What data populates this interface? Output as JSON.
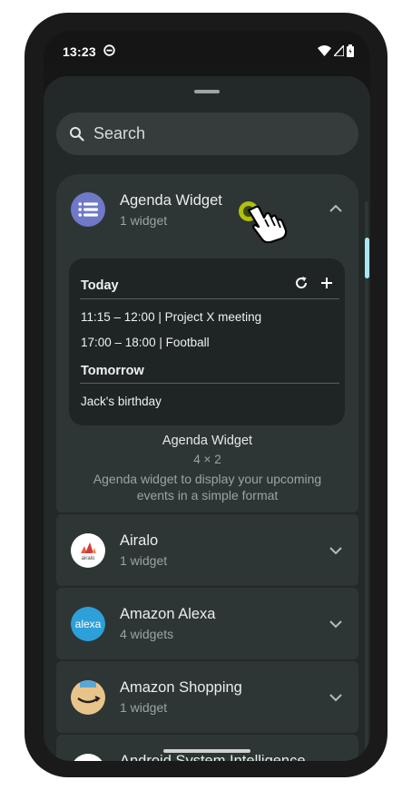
{
  "status": {
    "time": "13:23"
  },
  "search": {
    "placeholder": "Search"
  },
  "expanded_app": {
    "name": "Agenda Widget",
    "count": "1 widget",
    "icon": "list-icon",
    "icon_color": "#6f79c8",
    "preview": {
      "today_label": "Today",
      "events_today": [
        "11:15 – 12:00 | Project X meeting",
        "17:00 – 18:00 | Football"
      ],
      "tomorrow_label": "Tomorrow",
      "events_tomorrow": [
        "Jack's birthday"
      ]
    },
    "widget_title": "Agenda Widget",
    "widget_size": "4 × 2",
    "widget_description": "Agenda widget to display your upcoming events in a simple format"
  },
  "apps": [
    {
      "name": "Airalo",
      "count": "1 widget",
      "icon": "airalo-logo-icon",
      "icon_text": "airalo"
    },
    {
      "name": "Amazon Alexa",
      "count": "4 widgets",
      "icon": "alexa-logo-icon",
      "icon_text": "alexa"
    },
    {
      "name": "Amazon Shopping",
      "count": "1 widget",
      "icon": "amazon-logo-icon"
    },
    {
      "name": "Android System Intelligence",
      "count": "",
      "icon": "asi-logo-icon"
    }
  ],
  "colors": {
    "sheet": "#232828",
    "card": "#2e3535",
    "accent": "#a8e8ee"
  }
}
